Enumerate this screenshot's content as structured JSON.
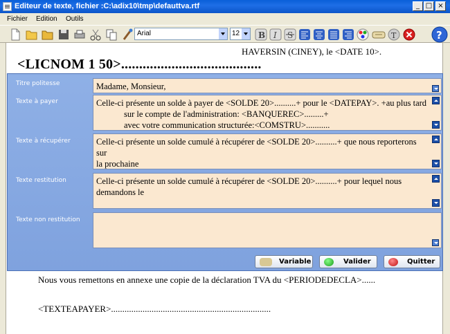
{
  "window": {
    "title": "Editeur de texte, fichier :C:\\adix10\\tmp\\defauttva.rtf",
    "minimize": "_",
    "maximize": "□",
    "close": "×"
  },
  "menu": {
    "items": [
      {
        "label": "Fichier"
      },
      {
        "label": "Edition"
      },
      {
        "label": "Outils"
      }
    ]
  },
  "toolbar": {
    "font": "Arial",
    "size": "12"
  },
  "document": {
    "header_line": "HAVERSIN (CINEY), le <DATE 10>.",
    "licnom": "<LICNOM 1 50>.......................................",
    "line1": "Nous vous remettons en annexe une copie de la déclaration TVA du <PERIODEDECLA>......",
    "line2": "<TEXTEAPAYER>......................................................................."
  },
  "form": {
    "fields": [
      {
        "label": "Titre politesse",
        "lines": [
          "Madame, Monsieur,"
        ]
      },
      {
        "label": "Texte à payer",
        "lines": [
          "Celle-ci présente un solde à payer de <SOLDE 20>..........+ pour le <DATEPAY>. +au plus tard",
          "sur le compte de l'administration: <BANQUEREC>.........+",
          "avec votre communication structurée:<COMSTRU>..........."
        ]
      },
      {
        "label": "Texte à récupérer",
        "lines": [
          "Celle-ci présente un solde cumulé à récupérer de <SOLDE 20>..........+ que nous reporterons sur",
          "la prochaine"
        ]
      },
      {
        "label": "Texte restitution",
        "lines": [
          "Celle-ci présente un solde cumulé à récupérer de <SOLDE 20>..........+ pour lequel nous",
          "demandons le"
        ]
      },
      {
        "label": "Texte non restitution",
        "lines": []
      }
    ],
    "buttons": {
      "variable": "Variable",
      "valider": "Valider",
      "quitter": "Quitter"
    }
  },
  "colors": {
    "panel": "#8fb0e6",
    "field_bg": "#fbe8d0",
    "titlebar": "#0a5fd8"
  }
}
